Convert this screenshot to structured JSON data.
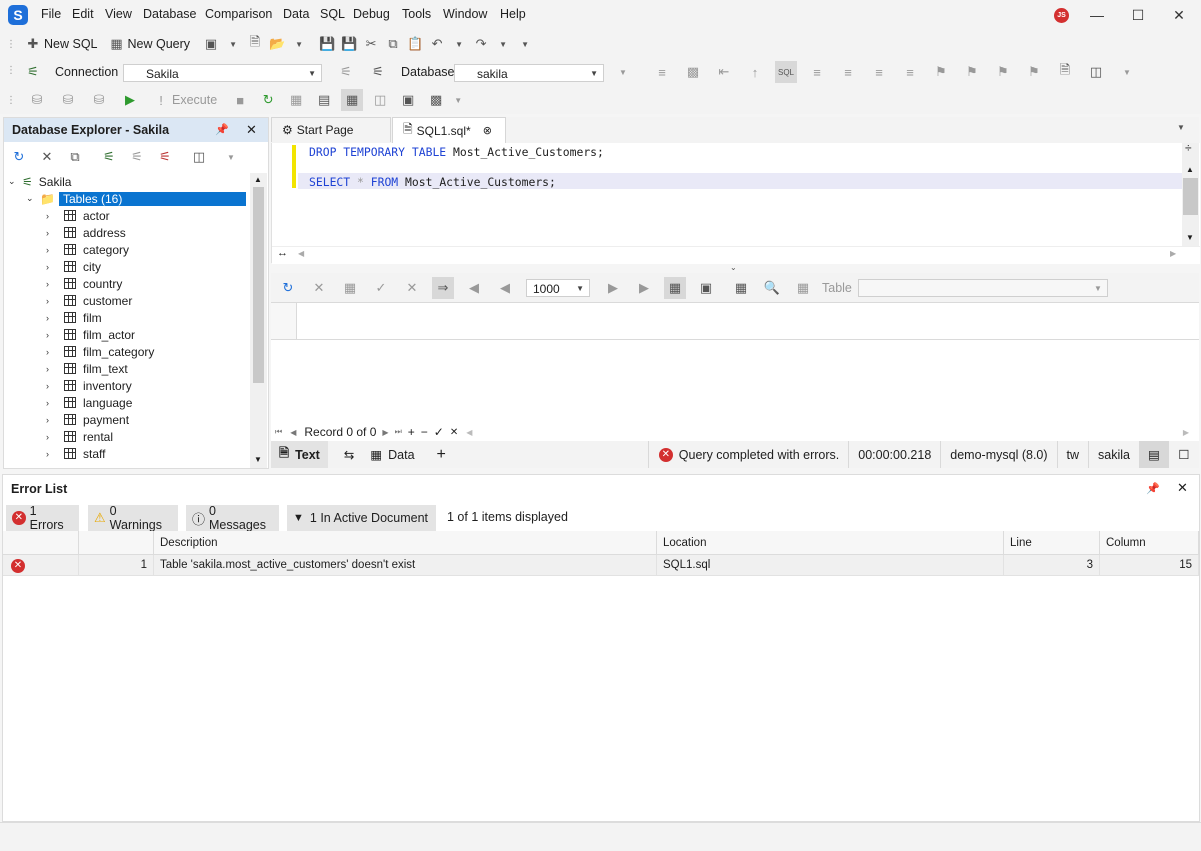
{
  "menu": [
    "File",
    "Edit",
    "View",
    "Database",
    "Comparison",
    "Data",
    "SQL",
    "Debug",
    "Tools",
    "Window",
    "Help"
  ],
  "app": {
    "logo_letter": "S",
    "user_initials": "JS"
  },
  "toolbar1": {
    "new_sql": "New SQL",
    "new_query": "New Query"
  },
  "toolbar2": {
    "connection_label": "Connection",
    "connection_value": "Sakila",
    "database_label": "Database",
    "database_value": "sakila"
  },
  "toolbar3": {
    "execute_label": "Execute"
  },
  "explorer": {
    "title": "Database Explorer - Sakila",
    "root": "Sakila",
    "tables_node": "Tables (16)",
    "tables": [
      "actor",
      "address",
      "category",
      "city",
      "country",
      "customer",
      "film",
      "film_actor",
      "film_category",
      "film_text",
      "inventory",
      "language",
      "payment",
      "rental",
      "staff"
    ]
  },
  "tabs": {
    "start_page": "Start Page",
    "sql1": "SQL1.sql*"
  },
  "editor": {
    "line1": {
      "kw1": "DROP TEMPORARY TABLE ",
      "rest": "Most_Active_Customers;"
    },
    "line3": {
      "kw1": "SELECT ",
      "op": "* ",
      "kw2": "FROM ",
      "rest": "Most_Active_Customers;"
    }
  },
  "grid": {
    "page_size": "1000",
    "table_label": "Table"
  },
  "navigator": {
    "record_text": "Record 0 of 0"
  },
  "status": {
    "text_tab": "Text",
    "data_tab": "Data",
    "message": "Query completed with errors.",
    "elapsed": "00:00:00.218",
    "server": "demo-mysql (8.0)",
    "user": "tw",
    "database": "sakila"
  },
  "error_list": {
    "title": "Error List",
    "filters": {
      "errors": "1 Errors",
      "warnings": "0 Warnings",
      "messages": "0 Messages",
      "active": "1 In Active Document",
      "count": "1 of 1 items displayed"
    },
    "columns": {
      "description": "Description",
      "location": "Location",
      "line": "Line",
      "column": "Column"
    },
    "rows": [
      {
        "index": "1",
        "description": "Table 'sakila.most_active_customers' doesn't exist",
        "location": "SQL1.sql",
        "line": "3",
        "column": "15"
      }
    ]
  },
  "colors": {
    "accent": "#1e6fd9",
    "error": "#d32f2f",
    "selection": "#0a74d0",
    "keyword": "#1f43d4"
  }
}
